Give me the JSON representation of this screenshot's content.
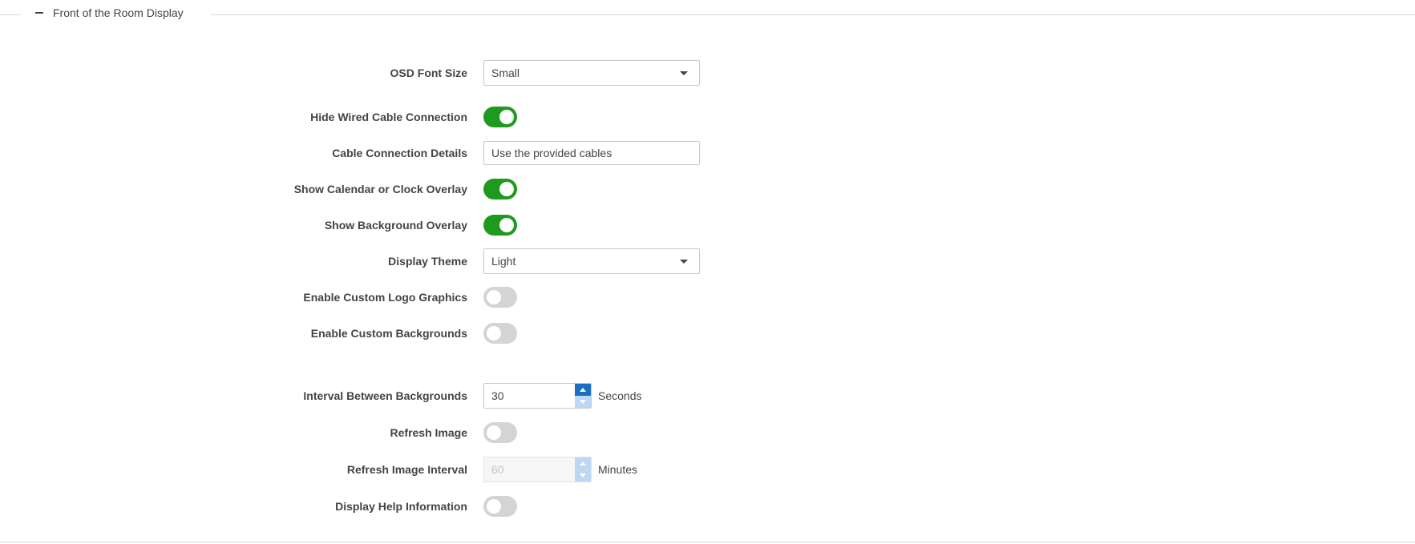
{
  "section": {
    "title": "Front of the Room Display"
  },
  "fields": {
    "osd_font_size": {
      "label": "OSD Font Size",
      "value": "Small"
    },
    "hide_wired_cable": {
      "label": "Hide Wired Cable Connection",
      "state": "on"
    },
    "cable_connection_details": {
      "label": "Cable Connection Details",
      "value": "Use the provided cables"
    },
    "show_calendar_clock": {
      "label": "Show Calendar or Clock Overlay",
      "state": "on"
    },
    "show_background_overlay": {
      "label": "Show Background Overlay",
      "state": "on"
    },
    "display_theme": {
      "label": "Display Theme",
      "value": "Light"
    },
    "enable_custom_logo": {
      "label": "Enable Custom Logo Graphics",
      "state": "off"
    },
    "enable_custom_backgrounds": {
      "label": "Enable Custom Backgrounds",
      "state": "off"
    },
    "interval_between_backgrounds": {
      "label": "Interval Between Backgrounds",
      "value": "30",
      "unit": "Seconds"
    },
    "refresh_image": {
      "label": "Refresh Image",
      "state": "off"
    },
    "refresh_image_interval": {
      "label": "Refresh Image Interval",
      "value": "60",
      "unit": "Minutes",
      "disabled": true
    },
    "display_help_information": {
      "label": "Display Help Information",
      "state": "off"
    }
  },
  "colors": {
    "toggle_on": "#1e9b1e",
    "toggle_off": "#d4d4d4",
    "spinner_accent": "#1a6fc4"
  },
  "icons": {
    "collapse": "minus-icon",
    "dropdown": "caret-down-icon",
    "spin_up": "arrow-up-icon",
    "spin_down": "arrow-down-icon"
  }
}
